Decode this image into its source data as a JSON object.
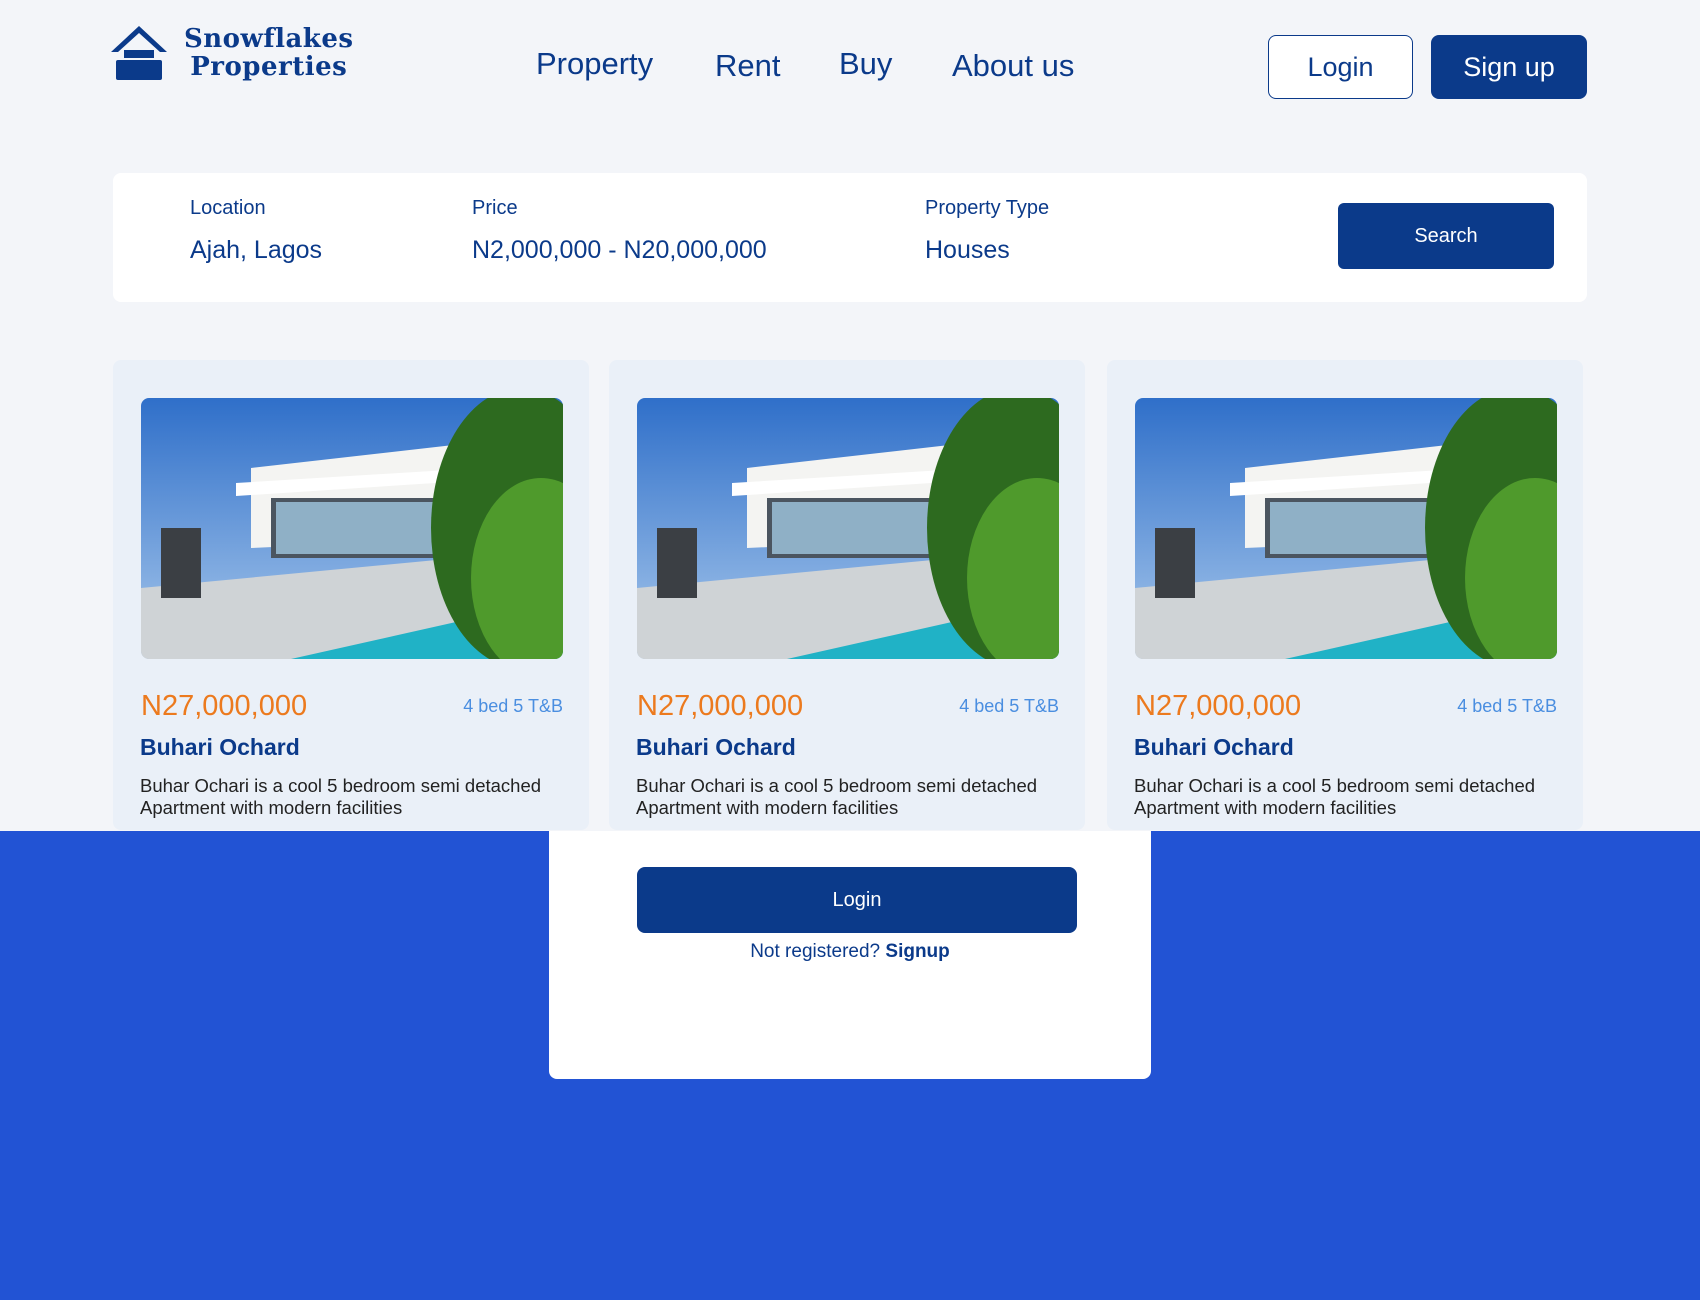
{
  "brand": {
    "line1": "Snowflakes",
    "line2": "Properties",
    "color": "#0b3a8a"
  },
  "nav": {
    "property": "Property",
    "rent": "Rent",
    "buy": "Buy",
    "about": "About us"
  },
  "auth": {
    "login": "Login",
    "signup": "Sign up"
  },
  "search": {
    "location_label": "Location",
    "location_value": "Ajah, Lagos",
    "price_label": "Price",
    "price_value": "N2,000,000 - N20,000,000",
    "type_label": "Property Type",
    "type_value": "Houses",
    "button": "Search"
  },
  "listings": [
    {
      "price": "N27,000,000",
      "specs": "4 bed 5 T&B",
      "title": "Buhari Ochard",
      "description": "Buhar Ochari is a cool  5 bedroom semi detached Apartment with modern facilities"
    },
    {
      "price": "N27,000,000",
      "specs": "4 bed 5 T&B",
      "title": "Buhari Ochard",
      "description": "Buhar Ochari is a cool  5 bedroom semi detached Apartment with modern facilities"
    },
    {
      "price": "N27,000,000",
      "specs": "4 bed 5 T&B",
      "title": "Buhari Ochard",
      "description": "Buhar Ochari is a cool  5 bedroom semi detached Apartment with modern facilities"
    }
  ],
  "modal": {
    "login_button": "Login",
    "prompt": "Not registered?",
    "signup_link": "Signup"
  },
  "colors": {
    "primary": "#0b3a8a",
    "accent_price": "#ec7a1e",
    "overlay": "#2253d4",
    "specs": "#4a8ee0"
  }
}
